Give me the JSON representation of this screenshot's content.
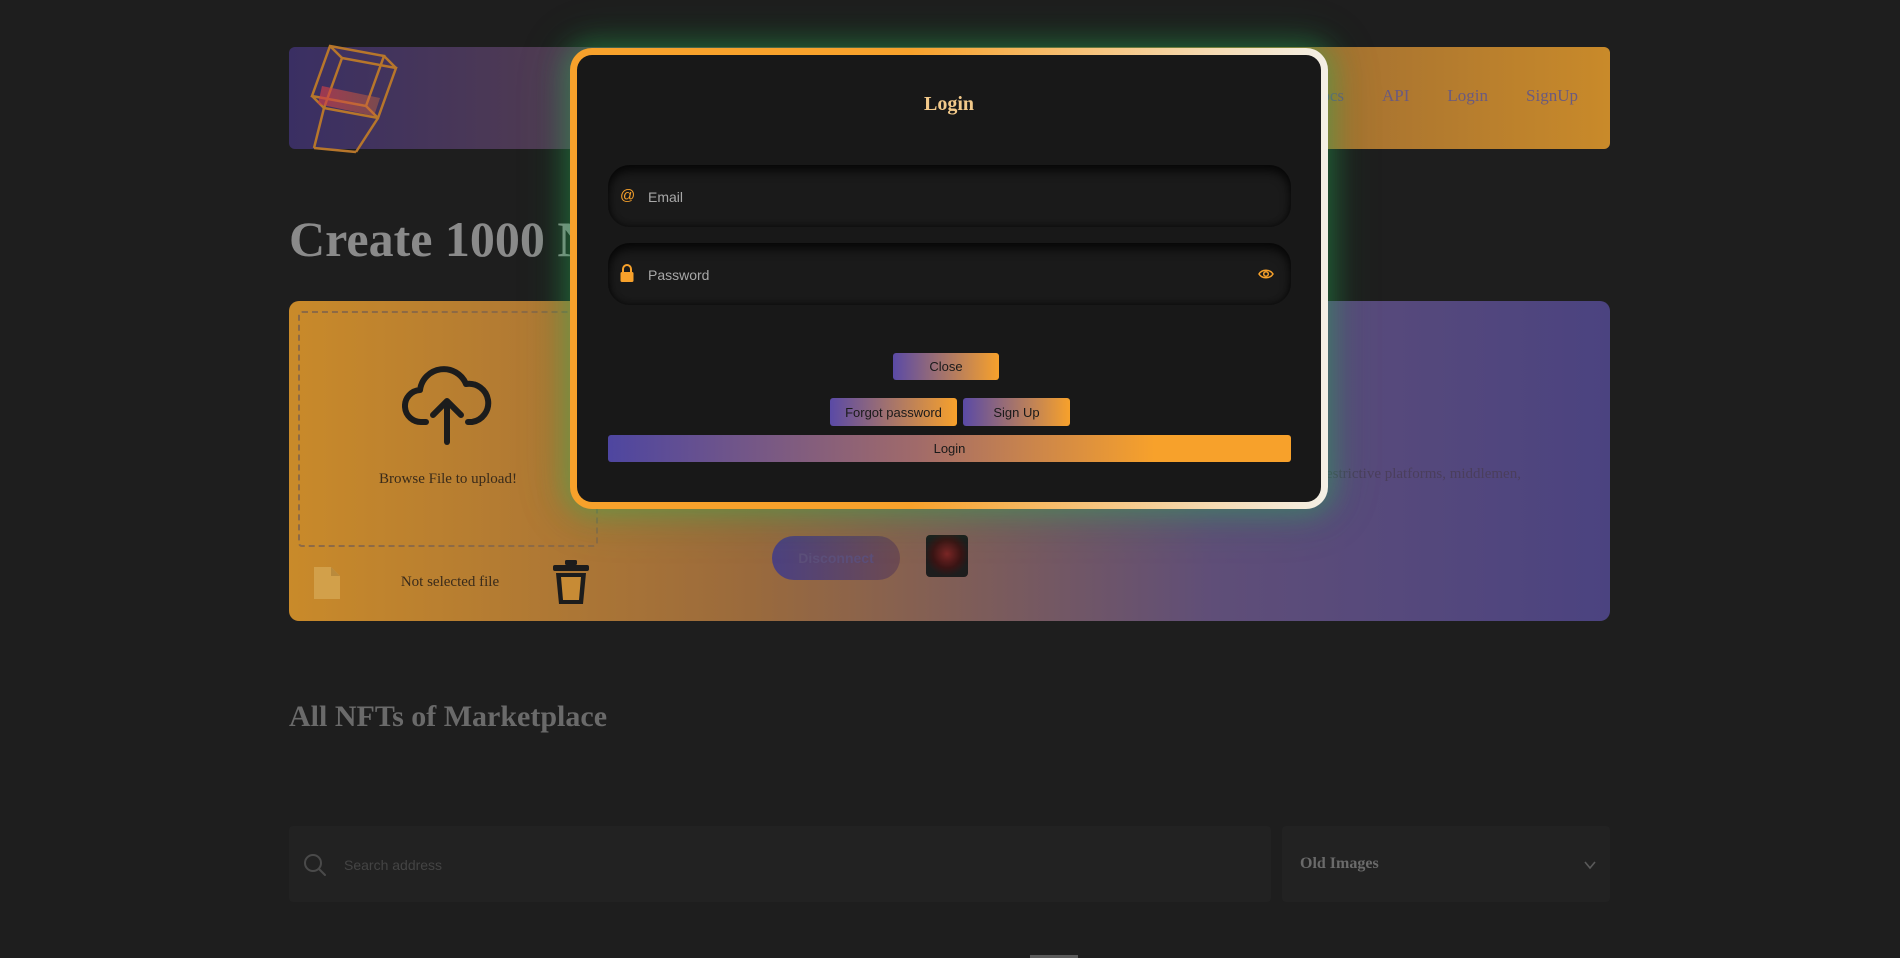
{
  "nav": {
    "items": [
      "Docs",
      "API",
      "Login",
      "SignUp"
    ]
  },
  "main": {
    "title": "Create 1000 N",
    "upload": {
      "browse_label": "Browse File to upload!",
      "file_label": "Not selected file"
    },
    "description": "estrictive platforms, middlemen,",
    "disconnect_label": "Disconnect"
  },
  "marketplace": {
    "title": "All NFTs of Marketplace",
    "search_placeholder": "Search address",
    "sort_value": "Old Images"
  },
  "modal": {
    "title": "Login",
    "email_placeholder": "Email",
    "password_placeholder": "Password",
    "close_label": "Close",
    "forgot_label": "Forgot password",
    "signup_label": "Sign Up",
    "login_label": "Login"
  },
  "colors": {
    "accent_orange": "#f7a12b",
    "accent_purple": "#5a4aa6",
    "modal_bg": "#181818",
    "page_bg": "#1e1e1e",
    "glow_green": "#28be5a"
  },
  "icons": [
    "logo-cube-icon",
    "cloud-upload-icon",
    "file-icon",
    "trash-icon",
    "search-icon",
    "chevron-down-icon",
    "at-icon",
    "lock-icon",
    "eye-icon"
  ]
}
